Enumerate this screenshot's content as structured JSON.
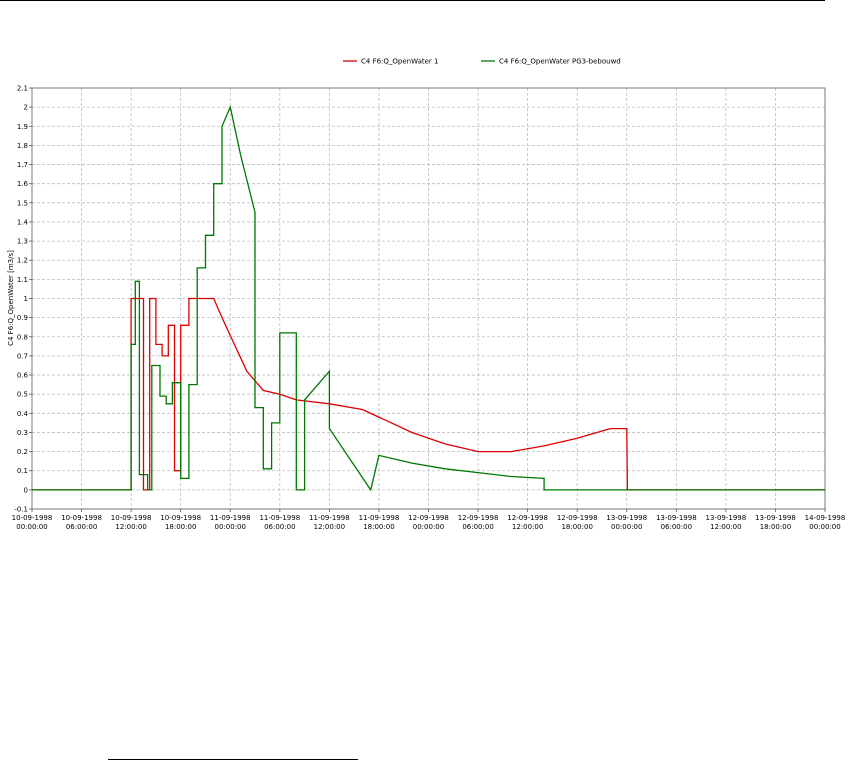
{
  "chart_data": {
    "type": "line",
    "title": "",
    "ylabel": "C4 F6:Q_OpenWater [m3/s]",
    "xlabel": "",
    "x_start": "10-09-1998 00:00:00",
    "x_end": "14-09-1998 00:00:00",
    "x_tick_labels": [
      [
        "10-09-1998",
        "00:00:00"
      ],
      [
        "10-09-1998",
        "06:00:00"
      ],
      [
        "10-09-1998",
        "12:00:00"
      ],
      [
        "10-09-1998",
        "18:00:00"
      ],
      [
        "11-09-1998",
        "00:00:00"
      ],
      [
        "11-09-1998",
        "06:00:00"
      ],
      [
        "11-09-1998",
        "12:00:00"
      ],
      [
        "11-09-1998",
        "18:00:00"
      ],
      [
        "12-09-1998",
        "00:00:00"
      ],
      [
        "12-09-1998",
        "06:00:00"
      ],
      [
        "12-09-1998",
        "12:00:00"
      ],
      [
        "12-09-1998",
        "18:00:00"
      ],
      [
        "13-09-1998",
        "00:00:00"
      ],
      [
        "13-09-1998",
        "06:00:00"
      ],
      [
        "13-09-1998",
        "12:00:00"
      ],
      [
        "13-09-1998",
        "18:00:00"
      ],
      [
        "14-09-1998",
        "00:00:00"
      ]
    ],
    "ylim": [
      -0.1,
      2.1
    ],
    "y_ticks": [
      -0.1,
      0,
      0.1,
      0.2,
      0.3,
      0.4,
      0.5,
      0.6,
      0.7,
      0.8,
      0.9,
      1,
      1.1,
      1.2,
      1.3,
      1.4,
      1.5,
      1.6,
      1.7,
      1.8,
      1.9,
      2,
      2.1
    ],
    "grid": true,
    "legend_position": "top-center",
    "series": [
      {
        "name": "C4 F6:Q_OpenWater 1",
        "color": "#dd0000",
        "x": [
          "10-09-1998 00:00",
          "10-09-1998 12:00",
          "10-09-1998 12:00",
          "10-09-1998 12:30",
          "10-09-1998 12:30",
          "10-09-1998 13:30",
          "10-09-1998 13:30",
          "10-09-1998 14:15",
          "10-09-1998 14:15",
          "10-09-1998 15:00",
          "10-09-1998 15:00",
          "10-09-1998 15:45",
          "10-09-1998 15:45",
          "10-09-1998 16:30",
          "10-09-1998 16:30",
          "10-09-1998 17:15",
          "10-09-1998 17:15",
          "10-09-1998 18:00",
          "10-09-1998 18:00",
          "10-09-1998 19:00",
          "10-09-1998 19:00",
          "10-09-1998 20:00",
          "10-09-1998 20:00",
          "10-09-1998 22:00",
          "10-09-1998 23:00",
          "11-09-1998 02:00",
          "11-09-1998 04:00",
          "11-09-1998 06:00",
          "11-09-1998 08:00",
          "11-09-1998 12:00",
          "11-09-1998 16:00",
          "11-09-1998 18:00",
          "11-09-1998 22:00",
          "12-09-1998 02:00",
          "12-09-1998 06:00",
          "12-09-1998 10:00",
          "12-09-1998 14:00",
          "12-09-1998 18:00",
          "12-09-1998 22:00",
          "13-09-1998 00:00",
          "13-09-1998 00:05",
          "14-09-1998 00:00"
        ],
        "y": [
          0,
          0,
          1,
          1,
          1,
          1,
          0,
          0,
          1,
          1,
          0.76,
          0.76,
          0.7,
          0.7,
          0.86,
          0.86,
          0.1,
          0.1,
          0.86,
          0.86,
          1,
          1,
          1,
          1,
          0.9,
          0.62,
          0.52,
          0.5,
          0.47,
          0.45,
          0.42,
          0.38,
          0.3,
          0.24,
          0.2,
          0.2,
          0.23,
          0.27,
          0.32,
          0.32,
          0,
          0
        ]
      },
      {
        "name": "C4 F6:Q_OpenWater PG3-bebouwd",
        "color": "#007700",
        "x": [
          "10-09-1998 00:00",
          "10-09-1998 12:00",
          "10-09-1998 12:00",
          "10-09-1998 12:30",
          "10-09-1998 12:30",
          "10-09-1998 13:00",
          "10-09-1998 13:00",
          "10-09-1998 14:00",
          "10-09-1998 14:00",
          "10-09-1998 14:30",
          "10-09-1998 14:30",
          "10-09-1998 15:30",
          "10-09-1998 15:30",
          "10-09-1998 16:15",
          "10-09-1998 16:15",
          "10-09-1998 17:00",
          "10-09-1998 17:00",
          "10-09-1998 18:00",
          "10-09-1998 18:00",
          "10-09-1998 19:00",
          "10-09-1998 19:00",
          "10-09-1998 20:00",
          "10-09-1998 20:00",
          "10-09-1998 21:00",
          "10-09-1998 21:00",
          "10-09-1998 22:00",
          "10-09-1998 22:00",
          "10-09-1998 23:00",
          "10-09-1998 23:00",
          "11-09-1998 00:00",
          "11-09-1998 01:15",
          "11-09-1998 03:00",
          "11-09-1998 03:00",
          "11-09-1998 04:00",
          "11-09-1998 04:00",
          "11-09-1998 05:00",
          "11-09-1998 05:00",
          "11-09-1998 06:00",
          "11-09-1998 06:00",
          "11-09-1998 08:00",
          "11-09-1998 08:00",
          "11-09-1998 09:00",
          "11-09-1998 09:00",
          "11-09-1998 12:00",
          "11-09-1998 12:00",
          "11-09-1998 17:00",
          "11-09-1998 17:00",
          "11-09-1998 18:00",
          "11-09-1998 22:00",
          "12-09-1998 02:00",
          "12-09-1998 06:00",
          "12-09-1998 10:00",
          "12-09-1998 14:00",
          "12-09-1998 14:00",
          "14-09-1998 00:00"
        ],
        "y": [
          0,
          0,
          0.76,
          0.76,
          1.09,
          1.09,
          0.08,
          0.08,
          0,
          0,
          0.65,
          0.65,
          0.49,
          0.49,
          0.45,
          0.45,
          0.56,
          0.56,
          0.06,
          0.06,
          0.55,
          0.55,
          1.16,
          1.16,
          1.33,
          1.33,
          1.6,
          1.6,
          1.9,
          2,
          1.75,
          1.45,
          0.43,
          0.43,
          0.11,
          0.11,
          0.35,
          0.35,
          0.82,
          0.82,
          0,
          0,
          0.47,
          0.62,
          0.32,
          0,
          0,
          0.18,
          0.14,
          0.11,
          0.09,
          0.07,
          0.06,
          0,
          0
        ]
      }
    ]
  }
}
